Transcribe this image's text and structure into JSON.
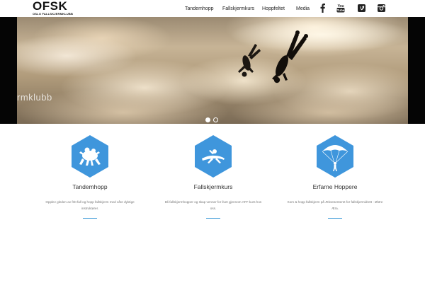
{
  "header": {
    "logo": {
      "main": "OFSK",
      "sub": "OSLO FALLSKJERMKLUBB"
    },
    "nav": [
      {
        "label": "Tandemhopp"
      },
      {
        "label": "Fallskjermkurs"
      },
      {
        "label": "Hoppfeltet"
      },
      {
        "label": "Media"
      }
    ],
    "social": [
      {
        "icon": "facebook-icon"
      },
      {
        "icon": "youtube-icon",
        "label": "You Tube"
      },
      {
        "icon": "vimeo-icon"
      },
      {
        "icon": "instagram-icon"
      }
    ]
  },
  "hero": {
    "overlay_text": "rmklubb",
    "slides": 2,
    "active_slide": 1
  },
  "features": [
    {
      "title": "Tandemhopp",
      "description": "Opplev gleden av fritt fall og hopp fallskjerm med våre dyktige instruktører.",
      "icon": "tandem-skydivers-icon"
    },
    {
      "title": "Fallskjermkurs",
      "description": "Bli fallskjermhopper og skap venner for livet gjennom AFF-kurs hos oss.",
      "icon": "freefall-skydiver-icon"
    },
    {
      "title": "Erfarne Hoppere",
      "description": "Kom & hopp fallskjerm på Æksesenteret for fallskjermidrett - Østre Æra.",
      "icon": "parachute-canopy-icon"
    }
  ],
  "colors": {
    "accent": "#3d9ad8",
    "hex_fill": "#3f96dc",
    "text": "#333333"
  }
}
